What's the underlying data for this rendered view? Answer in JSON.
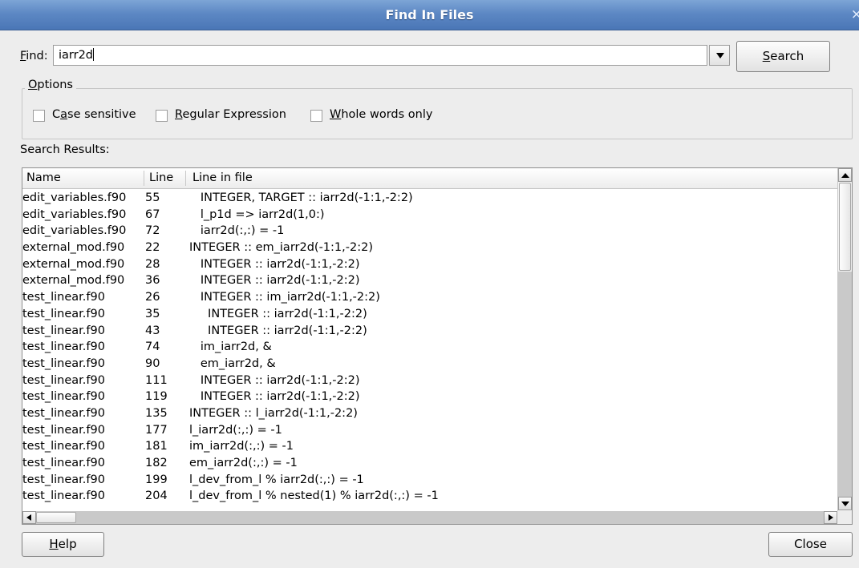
{
  "window": {
    "title": "Find In Files",
    "close_glyph": "×"
  },
  "find": {
    "label_prefix": "F",
    "label_rest": "ind:",
    "value": "iarr2d"
  },
  "search_button": {
    "u": "S",
    "rest": "earch"
  },
  "options": {
    "legend_u": "O",
    "legend_rest": "ptions",
    "case_sensitive": {
      "pre": "C",
      "u": "a",
      "post": "se sensitive",
      "checked": false
    },
    "regex": {
      "pre": "",
      "u": "R",
      "post": "egular Expression",
      "checked": false
    },
    "whole_words": {
      "pre": "",
      "u": "W",
      "post": "hole words only",
      "checked": false
    }
  },
  "results": {
    "label": "Search Results:",
    "columns": [
      "Name",
      "Line",
      "Line in file"
    ],
    "rows": [
      [
        "edit_variables.f90",
        "55",
        "   INTEGER, TARGET :: iarr2d(-1:1,-2:2)"
      ],
      [
        "edit_variables.f90",
        "67",
        "   l_p1d => iarr2d(1,0:)"
      ],
      [
        "edit_variables.f90",
        "72",
        "   iarr2d(:,:) = -1"
      ],
      [
        "external_mod.f90",
        "22",
        "INTEGER :: em_iarr2d(-1:1,-2:2)"
      ],
      [
        "external_mod.f90",
        "28",
        "   INTEGER :: iarr2d(-1:1,-2:2)"
      ],
      [
        "external_mod.f90",
        "36",
        "   INTEGER :: iarr2d(-1:1,-2:2)"
      ],
      [
        "test_linear.f90",
        "26",
        "   INTEGER :: im_iarr2d(-1:1,-2:2)"
      ],
      [
        "test_linear.f90",
        "35",
        "     INTEGER :: iarr2d(-1:1,-2:2)"
      ],
      [
        "test_linear.f90",
        "43",
        "     INTEGER :: iarr2d(-1:1,-2:2)"
      ],
      [
        "test_linear.f90",
        "74",
        "   im_iarr2d, &"
      ],
      [
        "test_linear.f90",
        "90",
        "   em_iarr2d, &"
      ],
      [
        "test_linear.f90",
        "111",
        "   INTEGER :: iarr2d(-1:1,-2:2)"
      ],
      [
        "test_linear.f90",
        "119",
        "   INTEGER :: iarr2d(-1:1,-2:2)"
      ],
      [
        "test_linear.f90",
        "135",
        "INTEGER :: l_iarr2d(-1:1,-2:2)"
      ],
      [
        "test_linear.f90",
        "177",
        "l_iarr2d(:,:) = -1"
      ],
      [
        "test_linear.f90",
        "181",
        "im_iarr2d(:,:) = -1"
      ],
      [
        "test_linear.f90",
        "182",
        "em_iarr2d(:,:) = -1"
      ],
      [
        "test_linear.f90",
        "199",
        "l_dev_from_l % iarr2d(:,:) = -1"
      ],
      [
        "test_linear.f90",
        "204",
        "l_dev_from_l % nested(1) % iarr2d(:,:) = -1"
      ]
    ]
  },
  "help_button": {
    "u": "H",
    "rest": "elp"
  },
  "close_button": {
    "label": "Close"
  }
}
